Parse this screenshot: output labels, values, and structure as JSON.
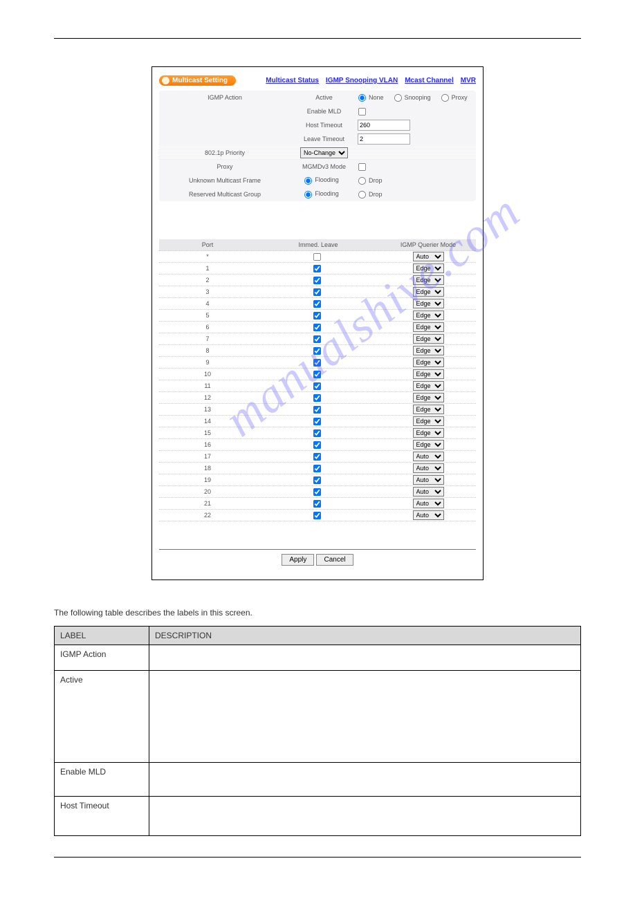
{
  "panel": {
    "title": "Multicast Setting",
    "links": [
      "Multicast Status",
      "IGMP Snooping VLAN",
      "Mcast Channel",
      "MVR"
    ]
  },
  "igmp": {
    "section_label": "IGMP Action",
    "active_label": "Active",
    "active_options": [
      "None",
      "Snooping",
      "Proxy"
    ],
    "enable_mld_label": "Enable MLD",
    "host_timeout_label": "Host Timeout",
    "host_timeout_value": "260",
    "leave_timeout_label": "Leave Timeout",
    "leave_timeout_value": "2"
  },
  "priority": {
    "label": "802.1p Priority",
    "value": "No-Change"
  },
  "proxy": {
    "label": "Proxy",
    "sub_label": "MGMDv3 Mode"
  },
  "umf": {
    "label": "Unknown Multicast Frame",
    "opt_flooding": "Flooding",
    "opt_drop": "Drop"
  },
  "rmg": {
    "label": "Reserved Multicast Group",
    "opt_flooding": "Flooding",
    "opt_drop": "Drop"
  },
  "port_table": {
    "h_port": "Port",
    "h_immed": "Immed. Leave",
    "h_mode": "IGMP Querier Mode",
    "rows": [
      {
        "port": "*",
        "checked": false,
        "mode": "Auto"
      },
      {
        "port": "1",
        "checked": true,
        "mode": "Edge"
      },
      {
        "port": "2",
        "checked": true,
        "mode": "Edge"
      },
      {
        "port": "3",
        "checked": true,
        "mode": "Edge"
      },
      {
        "port": "4",
        "checked": true,
        "mode": "Edge"
      },
      {
        "port": "5",
        "checked": true,
        "mode": "Edge"
      },
      {
        "port": "6",
        "checked": true,
        "mode": "Edge"
      },
      {
        "port": "7",
        "checked": true,
        "mode": "Edge"
      },
      {
        "port": "8",
        "checked": true,
        "mode": "Edge"
      },
      {
        "port": "9",
        "checked": true,
        "mode": "Edge"
      },
      {
        "port": "10",
        "checked": true,
        "mode": "Edge"
      },
      {
        "port": "11",
        "checked": true,
        "mode": "Edge"
      },
      {
        "port": "12",
        "checked": true,
        "mode": "Edge"
      },
      {
        "port": "13",
        "checked": true,
        "mode": "Edge"
      },
      {
        "port": "14",
        "checked": true,
        "mode": "Edge"
      },
      {
        "port": "15",
        "checked": true,
        "mode": "Edge"
      },
      {
        "port": "16",
        "checked": true,
        "mode": "Edge"
      },
      {
        "port": "17",
        "checked": true,
        "mode": "Auto"
      },
      {
        "port": "18",
        "checked": true,
        "mode": "Auto"
      },
      {
        "port": "19",
        "checked": true,
        "mode": "Auto"
      },
      {
        "port": "20",
        "checked": true,
        "mode": "Auto"
      },
      {
        "port": "21",
        "checked": true,
        "mode": "Auto"
      },
      {
        "port": "22",
        "checked": true,
        "mode": "Auto"
      }
    ]
  },
  "buttons": {
    "apply": "Apply",
    "cancel": "Cancel"
  },
  "desc_intro": "The following table describes the labels in this screen.",
  "desc_table": {
    "h1": "LABEL",
    "h2": "DESCRIPTION",
    "rows": [
      {
        "l": "IGMP Action",
        "d": ""
      },
      {
        "l": "Active",
        "d": ""
      },
      {
        "l": "Enable MLD",
        "d": ""
      },
      {
        "l": "Host Timeout",
        "d": ""
      }
    ]
  },
  "watermark": "manualshive.com"
}
